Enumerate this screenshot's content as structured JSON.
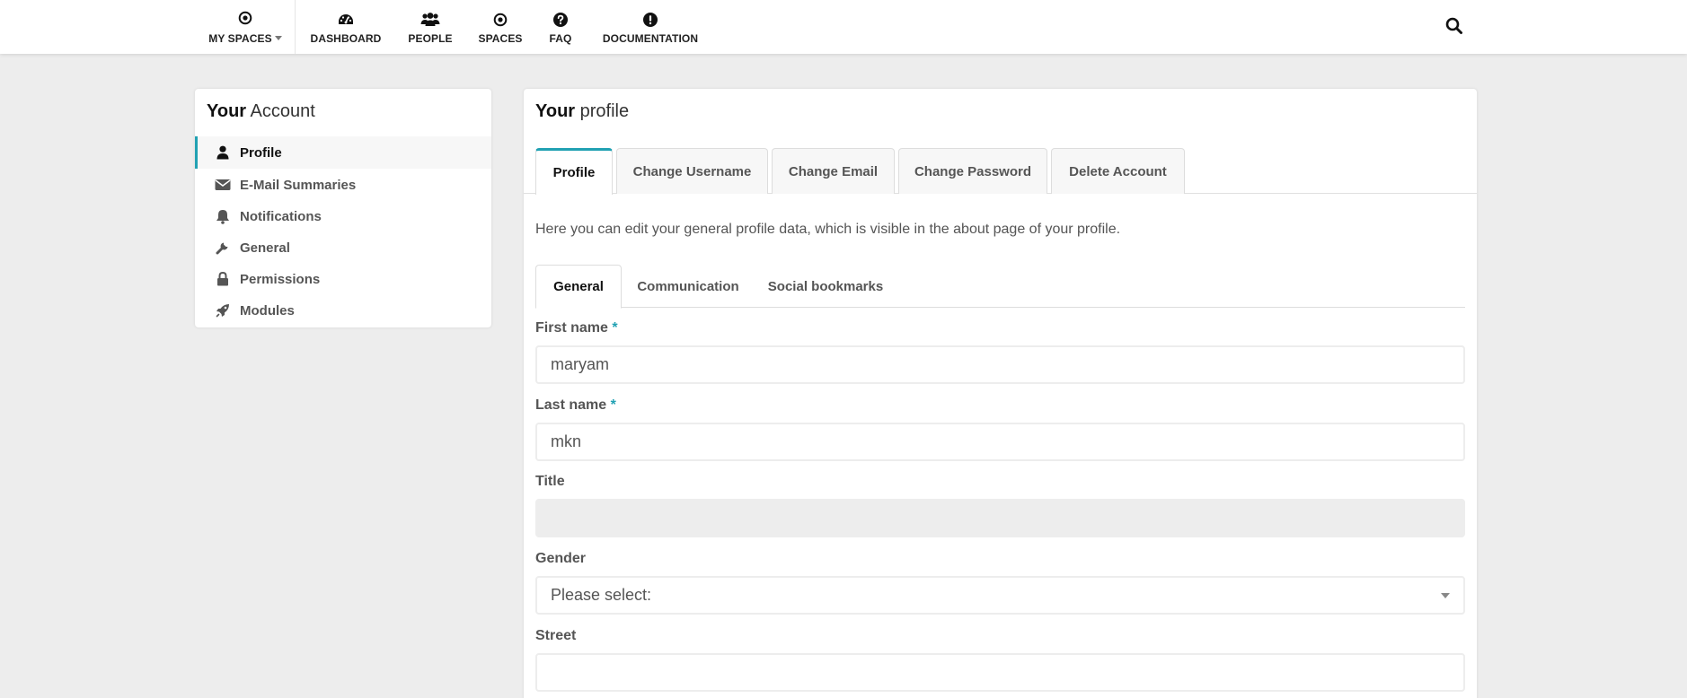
{
  "nav": {
    "items": [
      {
        "label": "MY SPACES",
        "icon": "dot-circle-icon"
      },
      {
        "label": "DASHBOARD",
        "icon": "dashboard-icon"
      },
      {
        "label": "PEOPLE",
        "icon": "users-icon"
      },
      {
        "label": "SPACES",
        "icon": "dot-circle-icon"
      },
      {
        "label": "FAQ",
        "icon": "question-circle-icon"
      },
      {
        "label": "DOCUMENTATION",
        "icon": "exclamation-circle-icon"
      }
    ],
    "search_icon": "search-icon"
  },
  "account": {
    "heading_bold": "Your",
    "heading_rest": " Account",
    "menu": [
      {
        "label": "Profile",
        "icon": "user-icon",
        "active": true
      },
      {
        "label": "E-Mail Summaries",
        "icon": "envelope-icon"
      },
      {
        "label": "Notifications",
        "icon": "bell-icon"
      },
      {
        "label": "General",
        "icon": "wrench-icon"
      },
      {
        "label": "Permissions",
        "icon": "lock-icon"
      },
      {
        "label": "Modules",
        "icon": "rocket-icon"
      }
    ]
  },
  "profile": {
    "heading_bold": "Your",
    "heading_rest": " profile",
    "tabs": [
      {
        "label": "Profile",
        "active": true
      },
      {
        "label": "Change Username"
      },
      {
        "label": "Change Email"
      },
      {
        "label": "Change Password"
      },
      {
        "label": "Delete Account"
      }
    ],
    "intro": "Here you can edit your general profile data, which is visible in the about page of your profile.",
    "subtabs": [
      {
        "label": "General",
        "active": true
      },
      {
        "label": "Communication"
      },
      {
        "label": "Social bookmarks"
      }
    ],
    "fields": {
      "first_name": {
        "label": "First name",
        "required_mark": "*",
        "value": "maryam"
      },
      "last_name": {
        "label": "Last name",
        "required_mark": "*",
        "value": "mkn"
      },
      "title": {
        "label": "Title",
        "value": ""
      },
      "gender": {
        "label": "Gender",
        "value": "Please select:"
      },
      "street": {
        "label": "Street",
        "value": ""
      }
    }
  },
  "colors": {
    "accent": "#21a1b3",
    "page_bg": "#ededed",
    "text": "#555555"
  }
}
